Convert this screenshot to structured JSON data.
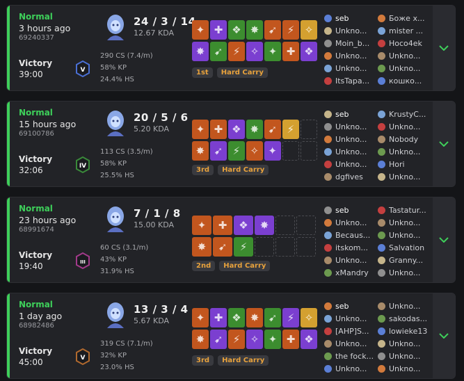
{
  "colors": {
    "win_accent": "#3ecf5a",
    "badge_text": "#e8a23c",
    "background": "#141518",
    "card": "#222327"
  },
  "matches": [
    {
      "mode": "Normal",
      "time_ago": "3 hours ago",
      "match_id": "69240337",
      "result": "Victory",
      "duration": "39:00",
      "rank_icon": "rank-badge-v",
      "rank_numeral": "V",
      "rank_color": "#4a6fd4",
      "kda": "24 / 3 / 14",
      "kda_ratio": "12.67 KDA",
      "cs": "290 CS (7.4/m)",
      "kp": "58% KP",
      "hs": "24.4% HS",
      "placement": "1st",
      "tag": "Hard Carry",
      "items": [
        [
          "#c2561e",
          "#7b3fd0",
          "#3c8d2f",
          "#3c8d2f",
          "#c2561e",
          "#c2561e",
          "#d4a030"
        ],
        [
          "#7b3fd0",
          "#3c8d2f",
          "#c2561e",
          "#7b3fd0",
          "#3c8d2f",
          "#c2561e",
          "#7b3fd0"
        ]
      ],
      "team_left": [
        "seb",
        "Unkno...",
        "Moin_b...",
        "Unkno...",
        "Unkno...",
        "ItsTapa..."
      ],
      "team_right": [
        "Боже х...",
        "mister ...",
        "Hoco4ek",
        "Unkno...",
        "Unkno...",
        "кошко..."
      ]
    },
    {
      "mode": "Normal",
      "time_ago": "15 hours ago",
      "match_id": "69100786",
      "result": "Victory",
      "duration": "32:06",
      "rank_icon": "rank-badge-iv",
      "rank_numeral": "IV",
      "rank_color": "#3a8a3a",
      "kda": "20 / 5 / 6",
      "kda_ratio": "5.20 KDA",
      "cs": "113 CS (3.5/m)",
      "kp": "58% KP",
      "hs": "25.5% HS",
      "placement": "3rd",
      "tag": "Hard Carry",
      "items": [
        [
          "#c2561e",
          "#c2561e",
          "#7b3fd0",
          "#3c8d2f",
          "#c2561e",
          "#d4a030",
          ""
        ],
        [
          "#c2561e",
          "#7b3fd0",
          "#3c8d2f",
          "#c2561e",
          "#7b3fd0",
          "",
          ""
        ]
      ],
      "team_left": [
        "seb",
        "Unkno...",
        "Unkno...",
        "Unkno...",
        "Unkno...",
        "dgfives"
      ],
      "team_right": [
        "KrustyC...",
        "Unkno...",
        "Nobody",
        "Unkno...",
        "Hori",
        "Unkno..."
      ]
    },
    {
      "mode": "Normal",
      "time_ago": "23 hours ago",
      "match_id": "68991674",
      "result": "Victory",
      "duration": "19:40",
      "rank_icon": "rank-badge-iii",
      "rank_numeral": "III",
      "rank_color": "#a23a8a",
      "kda": "7 / 1 / 8",
      "kda_ratio": "15.00 KDA",
      "cs": "60 CS (3.1/m)",
      "kp": "43% KP",
      "hs": "31.9% HS",
      "placement": "2nd",
      "tag": "Hard Carry",
      "items": [
        [
          "#c2561e",
          "#c2561e",
          "#7b3fd0",
          "#7b3fd0",
          "",
          ""
        ],
        [
          "#c2561e",
          "#c2561e",
          "#3c8d2f",
          "",
          "",
          ""
        ]
      ],
      "team_left": [
        "seb",
        "Unkno...",
        "Becaus...",
        "itskom...",
        "Unkno...",
        "xMandry"
      ],
      "team_right": [
        "Tastatur...",
        "Unkno...",
        "Unkno...",
        "Salvation",
        "Granny...",
        "Unkno..."
      ]
    },
    {
      "mode": "Normal",
      "time_ago": "1 day ago",
      "match_id": "68982486",
      "result": "Victory",
      "duration": "45:00",
      "rank_icon": "rank-badge-v",
      "rank_numeral": "V",
      "rank_color": "#b0692e",
      "kda": "13 / 3 / 4",
      "kda_ratio": "5.67 KDA",
      "cs": "319 CS (7.1/m)",
      "kp": "32% KP",
      "hs": "23.0% HS",
      "placement": "3rd",
      "tag": "Hard Carry",
      "items": [
        [
          "#c2561e",
          "#7b3fd0",
          "#3c8d2f",
          "#c2561e",
          "#3c8d2f",
          "#7b3fd0",
          "#d4a030"
        ],
        [
          "#c2561e",
          "#7b3fd0",
          "#c2561e",
          "#7b3fd0",
          "#3c8d2f",
          "#c2561e",
          "#7b3fd0"
        ]
      ],
      "team_left": [
        "seb",
        "Unkno...",
        "[AHP]S...",
        "Unkno...",
        "the fock...",
        "Unkno..."
      ],
      "team_right": [
        "Unkno...",
        "sakodas...",
        "lowieke13",
        "Unkno...",
        "Unkno...",
        "Unkno..."
      ]
    }
  ]
}
